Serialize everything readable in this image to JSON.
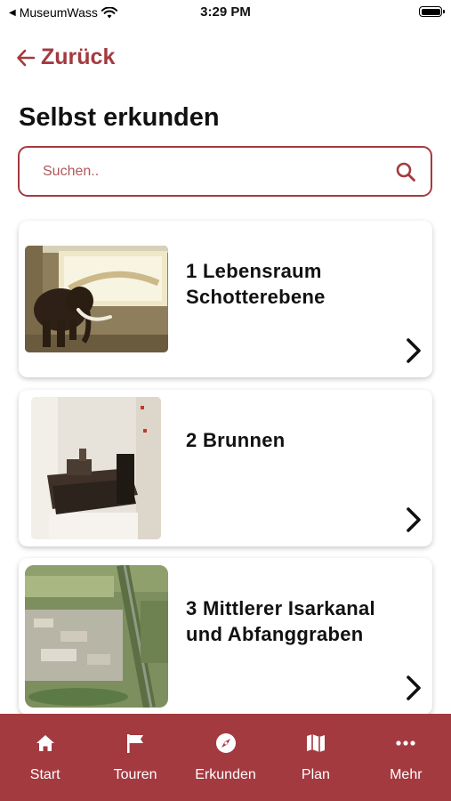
{
  "status": {
    "carrier": "MuseumWass",
    "time": "3:29 PM"
  },
  "header": {
    "back_label": "Zurück",
    "title": "Selbst erkunden"
  },
  "search": {
    "placeholder": "Suchen..",
    "value": ""
  },
  "colors": {
    "accent": "#a33a40",
    "text": "#111111",
    "background": "#ffffff"
  },
  "stations": [
    {
      "title": "1 Lebensraum Schotterebene",
      "image": "mammoth-exhibit"
    },
    {
      "title": "2 Brunnen",
      "image": "well-exhibit"
    },
    {
      "title": "3 Mittlerer Isarkanal und Abfanggraben",
      "image": "aerial-photo"
    }
  ],
  "nav": [
    {
      "label": "Start",
      "icon": "home-icon"
    },
    {
      "label": "Touren",
      "icon": "flag-icon"
    },
    {
      "label": "Erkunden",
      "icon": "compass-icon"
    },
    {
      "label": "Plan",
      "icon": "map-icon"
    },
    {
      "label": "Mehr",
      "icon": "more-icon"
    }
  ]
}
